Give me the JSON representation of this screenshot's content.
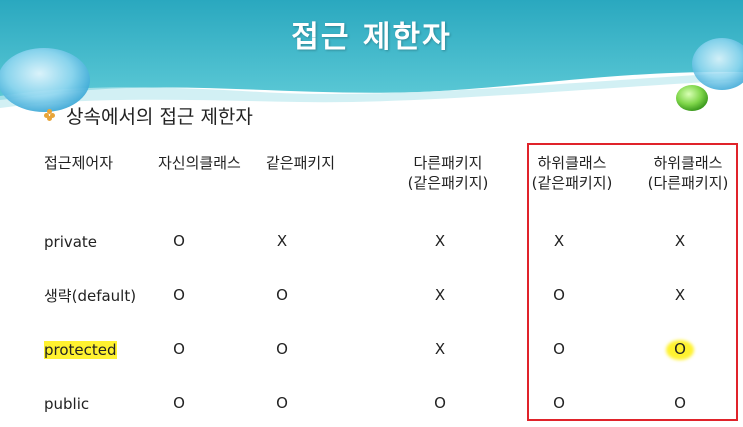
{
  "slide": {
    "title": "접근 제한자",
    "subtitle": "상속에서의 접근 제한자"
  },
  "table": {
    "headers": [
      {
        "line1": "접근제어자",
        "line2": ""
      },
      {
        "line1": "자신의클래스",
        "line2": ""
      },
      {
        "line1": "같은패키지",
        "line2": ""
      },
      {
        "line1": "다른패키지",
        "line2": "(같은패키지)"
      },
      {
        "line1": "하위클래스",
        "line2": "(같은패키지)"
      },
      {
        "line1": "하위클래스",
        "line2": "(다른패키지)"
      }
    ],
    "rows": [
      {
        "modifier": "private",
        "cells": [
          "O",
          "X",
          "X",
          "X",
          "X"
        ]
      },
      {
        "modifier": "생략(default)",
        "cells": [
          "O",
          "O",
          "X",
          "O",
          "X"
        ]
      },
      {
        "modifier": "protected",
        "cells": [
          "O",
          "O",
          "X",
          "O",
          "O"
        ]
      },
      {
        "modifier": "public",
        "cells": [
          "O",
          "O",
          "O",
          "O",
          "O"
        ]
      }
    ]
  },
  "colors": {
    "banner_teal": "#3fb6c9",
    "highlight": "#fff230",
    "red_box": "#e0232a",
    "bullet": "#e8a53a"
  }
}
